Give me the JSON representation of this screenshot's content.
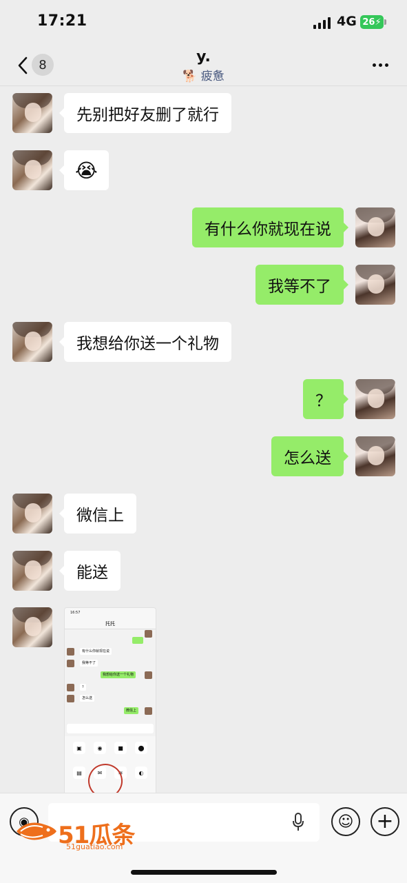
{
  "status_bar": {
    "time": "17:21",
    "network": "4G",
    "battery": "26"
  },
  "header": {
    "unread_count": "8",
    "contact_name": "y.",
    "status": "疲惫",
    "icons": {
      "back": "chevron-left-icon",
      "status": "dog-icon",
      "more": "ellipsis-icon"
    }
  },
  "messages": [
    {
      "side": "left",
      "text": "先别把好友删了就行"
    },
    {
      "side": "left",
      "text": "😭",
      "kind": "emoji"
    },
    {
      "side": "right",
      "text": "有什么你就现在说"
    },
    {
      "side": "right",
      "text": "我等不了"
    },
    {
      "side": "left",
      "text": "我想给你送一个礼物"
    },
    {
      "side": "right",
      "text": "？"
    },
    {
      "side": "right",
      "text": "怎么送"
    },
    {
      "side": "left",
      "text": "微信上"
    },
    {
      "side": "left",
      "text": "能送"
    },
    {
      "side": "left",
      "kind": "image"
    }
  ],
  "screenshot_message": {
    "time": "16:57",
    "title": "托托",
    "rows": [
      "有什么你就现在说",
      "我等不了",
      "我想给你送一个礼物",
      "?",
      "怎么送",
      "微信上"
    ]
  },
  "input_bar": {
    "icons": {
      "voice": "voice-icon",
      "mic": "microphone-icon",
      "emoji": "smiley-icon",
      "plus": "plus-icon"
    }
  },
  "watermark": {
    "brand": "51瓜条",
    "url": "51guatiao.com"
  },
  "colors": {
    "background": "#ededed",
    "sent_bubble": "#95ec69",
    "received_bubble": "#ffffff",
    "watermark": "#ee6f1c"
  }
}
